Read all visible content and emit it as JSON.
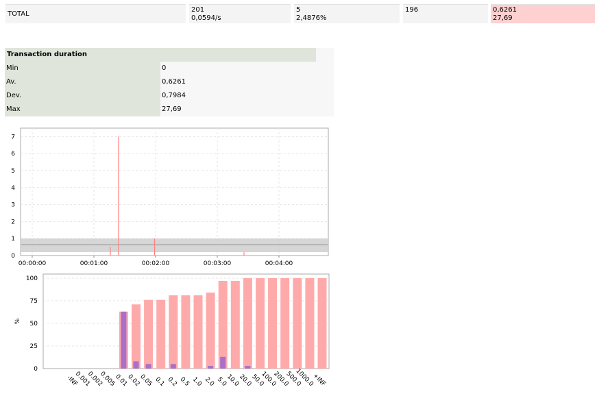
{
  "total": {
    "label": "TOTAL",
    "requests": "201",
    "rate": "0,0594/s",
    "errors": "5",
    "error_pct": "2,4876%",
    "ok": "196",
    "avg": "0,6261",
    "max": "27,69"
  },
  "duration": {
    "title": "Transaction duration",
    "rows": [
      {
        "key": "Min",
        "value": "0"
      },
      {
        "key": "Av.",
        "value": "0,6261"
      },
      {
        "key": "Dev.",
        "value": "0,7984"
      },
      {
        "key": "Max",
        "value": "27,69"
      }
    ]
  },
  "colors": {
    "spike": "#ff8080",
    "band": "#c8c8c8",
    "bar_pink": "#ffaaaa",
    "bar_purple": "#9966cc"
  },
  "chart_data": [
    {
      "type": "line",
      "xlabel": "",
      "ylabel": "",
      "xticks": [
        "00:00:00",
        "00:01:00",
        "00:02:00",
        "00:03:00",
        "00:04:00"
      ],
      "yticks": [
        "0",
        "1",
        "2",
        "3",
        "4",
        "5",
        "6",
        "7"
      ],
      "ylim": [
        0,
        7.5
      ],
      "xlim_seconds": [
        0,
        300
      ],
      "grid": true,
      "spikes": [
        {
          "t": 76,
          "v": 0.5
        },
        {
          "t": 84,
          "v": 7.0
        },
        {
          "t": 119,
          "v": 1.0
        },
        {
          "t": 206,
          "v": 0.2
        }
      ],
      "avg_band": {
        "low": 0.2,
        "high": 1.0,
        "mean": 0.63
      }
    },
    {
      "type": "bar",
      "ylabel": "%",
      "ylim": [
        0,
        100
      ],
      "yticks": [
        "0",
        "25",
        "50",
        "75",
        "100"
      ],
      "grid": true,
      "categories": [
        "-INF",
        "0.001",
        "0.002",
        "0.005",
        "0.01",
        "0.02",
        "0.05",
        "0.1",
        "0.2",
        "0.5",
        "1.0",
        "2.0",
        "5.0",
        "10.0",
        "20.0",
        "50.0",
        "100.0",
        "200.0",
        "500.0",
        "1000.0",
        "+INF"
      ],
      "series": [
        {
          "values": [
            0,
            0,
            0,
            0,
            63,
            71,
            76,
            76,
            81,
            81,
            81,
            84,
            97,
            97,
            100,
            100,
            100,
            100,
            100,
            100,
            100
          ]
        },
        {
          "values": [
            0,
            0,
            0,
            0,
            63,
            8,
            5,
            0,
            5,
            0,
            0,
            3,
            13,
            0,
            3,
            0,
            0,
            0,
            0,
            0,
            0
          ]
        }
      ]
    }
  ]
}
